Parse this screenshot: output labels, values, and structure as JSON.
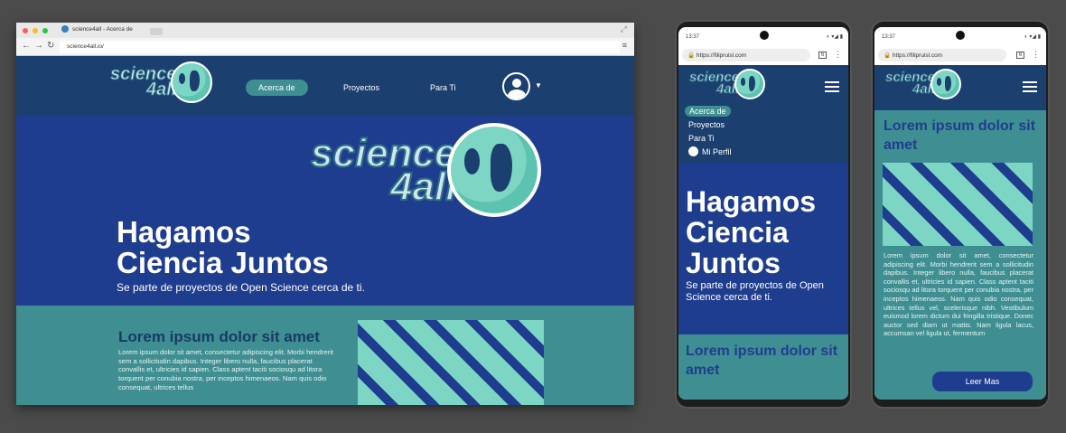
{
  "logo": {
    "line1": "science",
    "line2": "4all"
  },
  "desktop": {
    "tab_title": "science4all - Acerca de",
    "url": "science4all.io/",
    "nav": [
      {
        "label": "Acerca de",
        "active": true
      },
      {
        "label": "Proyectos"
      },
      {
        "label": "Para Ti"
      }
    ],
    "hero_title_1": "Hagamos",
    "hero_title_2": "Ciencia Juntos",
    "hero_subtitle": "Se parte de proyectos de Open Science cerca de ti.",
    "section_title": "Lorem ipsum dolor sit amet",
    "section_body": "Lorem ipsum dolor sit amet, consectetur adipiscing elit. Morbi hendrerit sem a sollicitudin dapibus. Integer libero nulla, faucibus placerat convallis et, ultricies id sapien. Class aptent taciti sociosqu ad litora torquent per conubia nostra, per inceptos himenaeos. Nam quis odio consequat, ultrices tellus"
  },
  "phone1": {
    "time": "13:37",
    "url": "https://filipruisl.com",
    "tabs": "6",
    "menu": [
      {
        "label": "Acerca de",
        "active": true
      },
      {
        "label": "Proyectos"
      },
      {
        "label": "Para Ti"
      },
      {
        "label": "Mi Perfil"
      }
    ],
    "hero_title_1": "Hagamos",
    "hero_title_2": "Ciencia",
    "hero_title_3": "Juntos",
    "hero_subtitle": "Se parte de proyectos de Open Science cerca de ti.",
    "section_title": "Lorem ipsum dolor sit amet"
  },
  "phone2": {
    "time": "13:37",
    "url": "https://filipruisl.com",
    "tabs": "6",
    "section_title": "Lorem ipsum dolor sit amet",
    "section_body": "Lorem ipsum dolor sit amet, consectetur adipiscing elit. Morbi hendrerit sem a sollicitudin dapibus. Integer libero nulla, faucibus placerat convallis et, ultricies id sapien. Class aptent taciti sociosqu ad litora torquent per conubia nostra, per inceptos himenaeos. Nam quis odio consequat, ultrices tellus vel, scelerisque nibh. Vestibulum euismod lorem dictum dui fringilla tristique. Donec auctor sed diam ut mattis. Nam ligula lacus, accumsan vel ligula ut, fermentum",
    "read_more": "Leer Mas"
  },
  "colors": {
    "header": "#1b3f6e",
    "hero": "#1f3d8f",
    "section": "#3f8f92",
    "mint": "#7dd6c4"
  }
}
